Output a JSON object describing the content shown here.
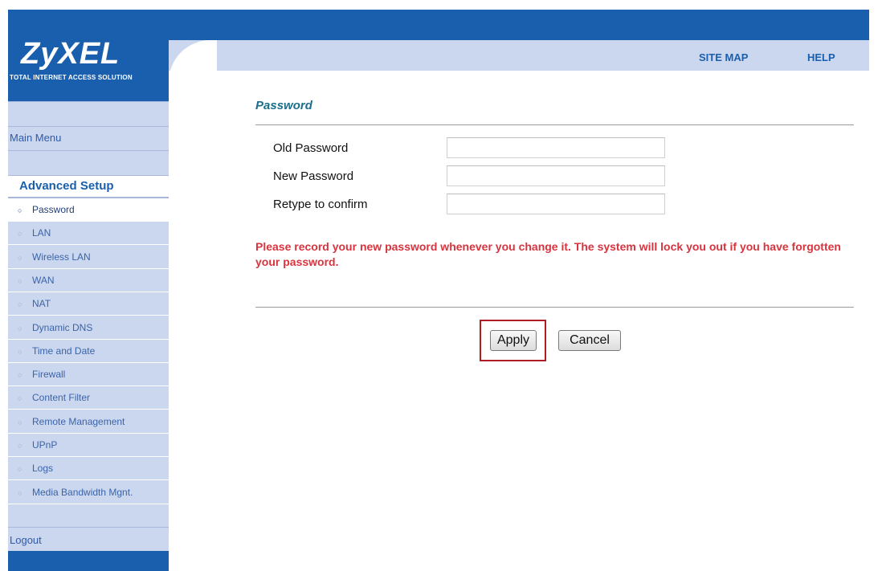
{
  "brand": {
    "logo_text": "ZyXEL",
    "tagline": "TOTAL INTERNET ACCESS SOLUTION"
  },
  "header_links": {
    "site_map": "SITE MAP",
    "help": "HELP"
  },
  "sidebar": {
    "main_menu": "Main Menu",
    "advanced_setup": "Advanced Setup",
    "items": [
      {
        "label": "Password",
        "active": true
      },
      {
        "label": "LAN"
      },
      {
        "label": "Wireless LAN"
      },
      {
        "label": "WAN"
      },
      {
        "label": "NAT"
      },
      {
        "label": "Dynamic DNS"
      },
      {
        "label": "Time and Date"
      },
      {
        "label": "Firewall"
      },
      {
        "label": "Content Filter"
      },
      {
        "label": "Remote Management"
      },
      {
        "label": "UPnP"
      },
      {
        "label": "Logs"
      },
      {
        "label": "Media Bandwidth Mgnt."
      }
    ],
    "logout": "Logout",
    "bullet": "○"
  },
  "form": {
    "title": "Password",
    "old_password_label": "Old Password",
    "old_password_value": "",
    "new_password_label": "New Password",
    "new_password_value": "",
    "confirm_label": "Retype to confirm",
    "confirm_value": "",
    "warning": "Please record your new password whenever you change it. The system will lock you out if you have forgotten your password.",
    "apply_label": "Apply",
    "cancel_label": "Cancel"
  },
  "colors": {
    "brand_blue": "#1a5fad",
    "light_blue": "#cbd7ef",
    "warning_red": "#d8343f",
    "highlight_red": "#b01e25"
  }
}
